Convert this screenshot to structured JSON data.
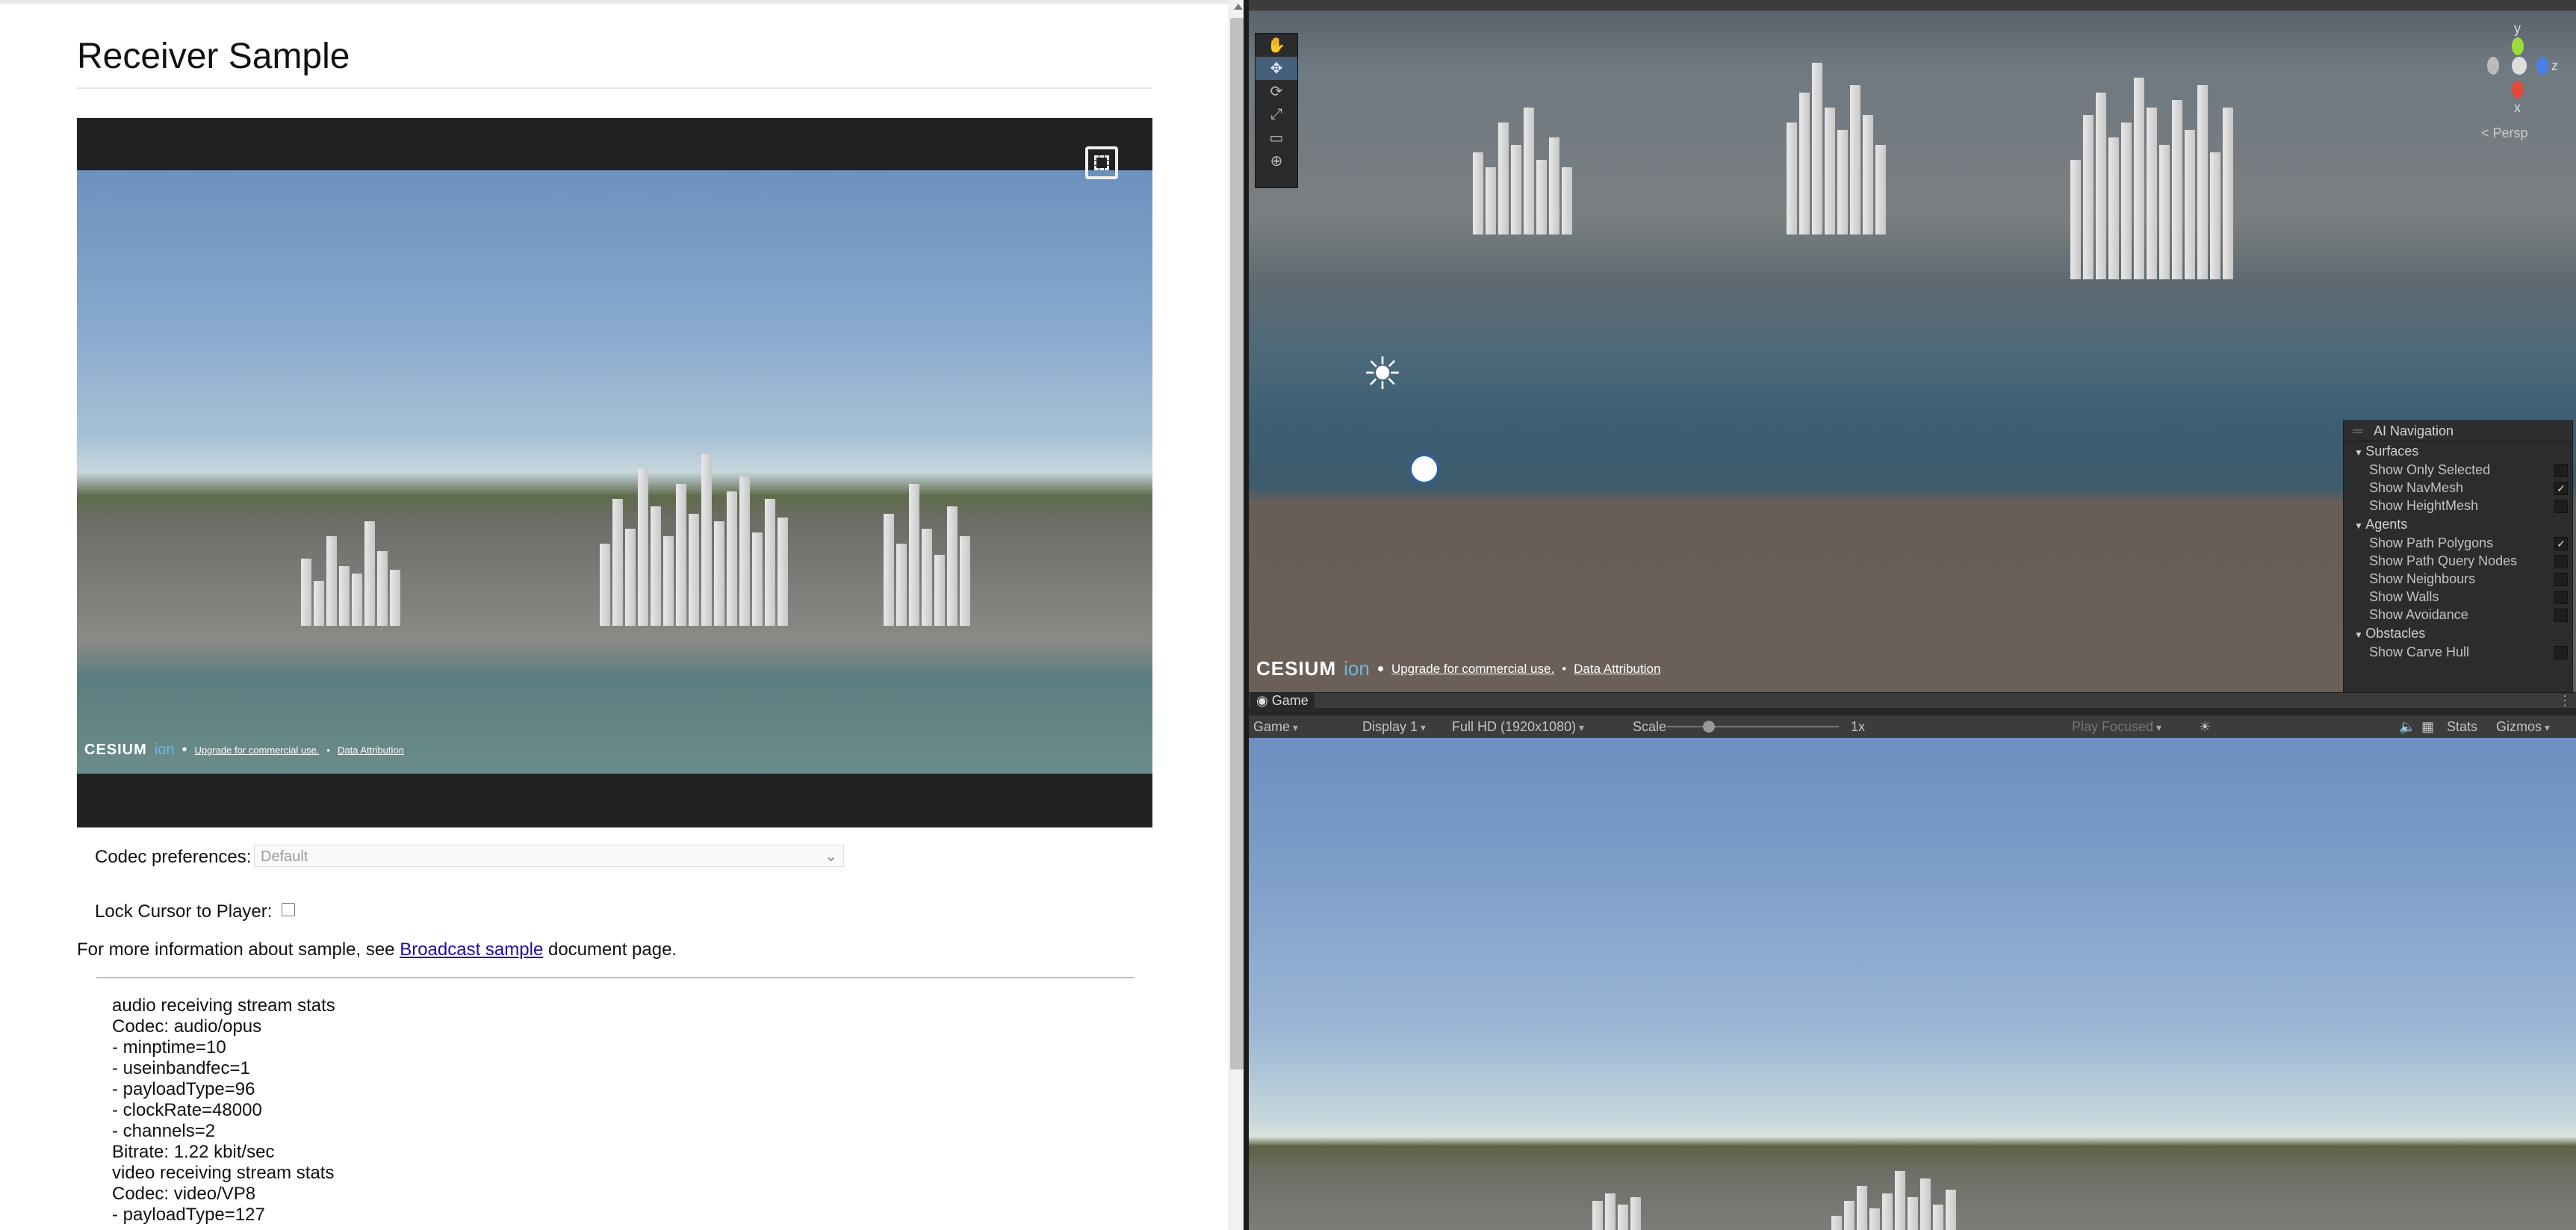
{
  "browser": {
    "page_title": "Receiver Sample",
    "player": {
      "cesium_logo": "CESIUM",
      "cesium_ion": "ion",
      "cesium_upgrade": "Upgrade for commercial use.",
      "cesium_attribution": "Data Attribution",
      "bullet": "•"
    },
    "codec": {
      "label": "Codec preferences:",
      "value": "Default"
    },
    "lock_cursor": {
      "label": "Lock Cursor to Player:",
      "checked": false
    },
    "info": {
      "prefix": "For more information about sample, see",
      "link": "Broadcast sample",
      "suffix": "document page."
    },
    "stats": [
      "audio receiving stream stats",
      "Codec: audio/opus",
      "- minptime=10",
      "- useinbandfec=1",
      "- payloadType=96",
      "- clockRate=48000",
      "- channels=2",
      "Bitrate: 1.22 kbit/sec",
      "video receiving stream stats",
      "Codec: video/VP8",
      "- payloadType=127"
    ]
  },
  "unity": {
    "scene": {
      "gizmo": {
        "y": "y",
        "x": "x",
        "z": "z"
      },
      "persp_label": "< Persp",
      "cesium_logo": "CESIUM",
      "cesium_ion": "ion",
      "cesium_upgrade": "Upgrade for commercial use.",
      "cesium_attribution": "Data Attribution",
      "bullet": "•",
      "tools": [
        "hand-tool",
        "move-tool",
        "rotate-tool",
        "scale-tool",
        "rect-tool",
        "transform-tool"
      ]
    },
    "ai_navigation": {
      "title": "AI Navigation",
      "sections": [
        {
          "name": "Surfaces",
          "rows": [
            {
              "label": "Show Only Selected",
              "checked": false
            },
            {
              "label": "Show NavMesh",
              "checked": true
            },
            {
              "label": "Show HeightMesh",
              "checked": false
            }
          ]
        },
        {
          "name": "Agents",
          "rows": [
            {
              "label": "Show Path Polygons",
              "checked": true
            },
            {
              "label": "Show Path Query Nodes",
              "checked": false
            },
            {
              "label": "Show Neighbours",
              "checked": false
            },
            {
              "label": "Show Walls",
              "checked": false
            },
            {
              "label": "Show Avoidance",
              "checked": false
            }
          ]
        },
        {
          "name": "Obstacles",
          "rows": [
            {
              "label": "Show Carve Hull",
              "checked": false
            }
          ]
        }
      ]
    },
    "game": {
      "tab_label": "Game",
      "menu_icon": "⋮",
      "view_mode": "Game",
      "display": "Display 1",
      "resolution": "Full HD (1920x1080)",
      "scale_label": "Scale",
      "scale_value": "1x",
      "play_focus": "Play Focused",
      "stats": "Stats",
      "gizmos": "Gizmos"
    }
  },
  "colors": {
    "link": "#1a0dab",
    "unity_panel": "#282828",
    "unity_toolbar": "#3c3c3c",
    "cesium_ion": "#6fb7e0"
  }
}
